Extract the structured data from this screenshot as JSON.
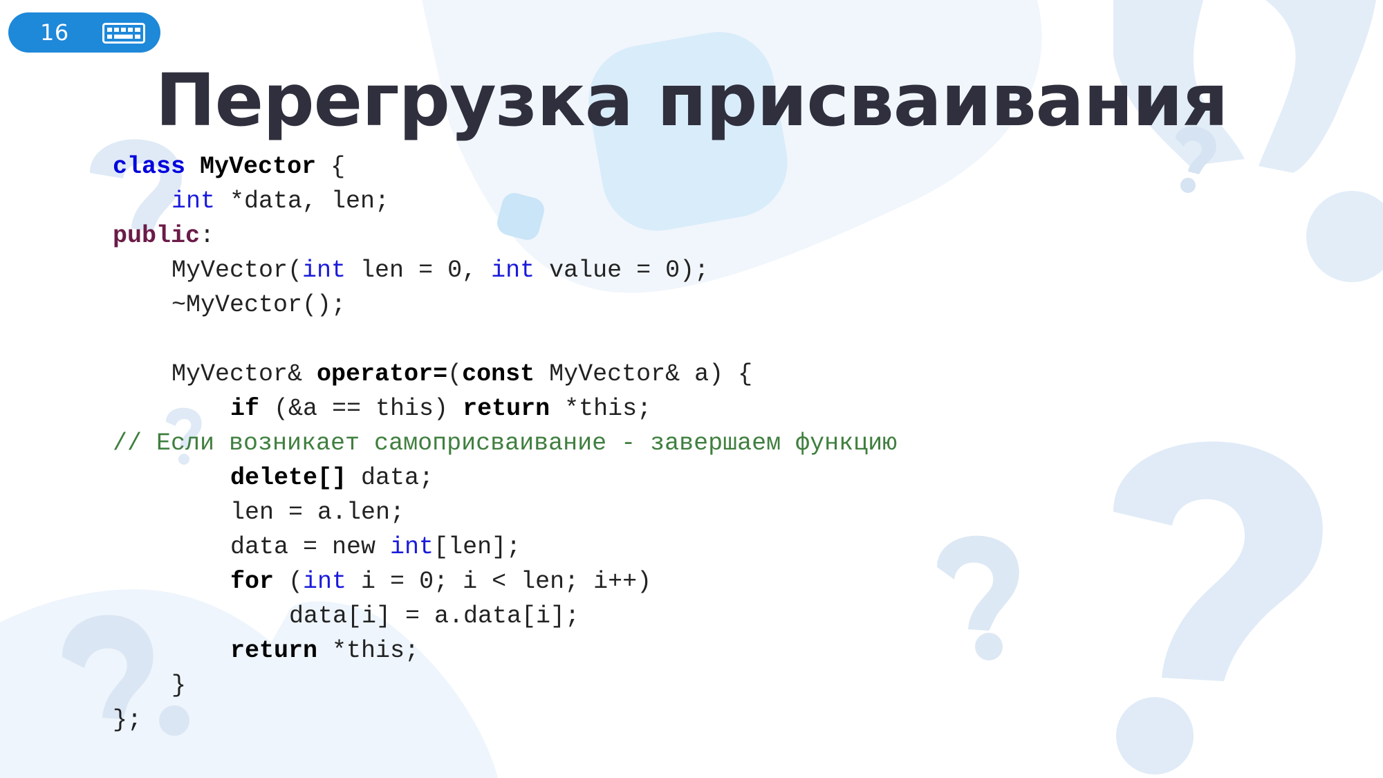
{
  "slide": {
    "number": "16",
    "badge_icon": "keyboard-icon",
    "title": "Перегрузка присваивания",
    "colors": {
      "badge": "#1e88d9",
      "title": "#2f2f3d",
      "keyword": "#0000dd",
      "type": "#1a1adb",
      "access_specifier": "#6b1b47",
      "comment": "#3f7f3f",
      "decoration": "#dbe8f6"
    }
  },
  "code": {
    "l1": {
      "kw": "class",
      "sp": " ",
      "name": "MyVector",
      "rest": " {"
    },
    "l2": {
      "type": "int",
      "rest": " *data, len;"
    },
    "l3": {
      "access": "public",
      "rest": ":"
    },
    "l4": {
      "a": "MyVector(",
      "t1": "int",
      "b": " len = 0, ",
      "t2": "int",
      "c": " value = 0);"
    },
    "l5": {
      "text": "~MyVector();"
    },
    "l6": {
      "text": ""
    },
    "l7": {
      "a": "MyVector& ",
      "op": "operator=",
      "b": "(",
      "const": "const",
      "c": " MyVector& a) {"
    },
    "l8": {
      "kw": "if",
      "a": " (&a == this) ",
      "ret": "return",
      "b": " *this;"
    },
    "l9": {
      "comment": "// Если возникает самоприсваивание - завершаем функцию"
    },
    "l10": {
      "kw": "delete[]",
      "rest": " data;"
    },
    "l11": {
      "text": "len = a.len;"
    },
    "l12": {
      "a": "data = new ",
      "type": "int",
      "b": "[len];"
    },
    "l13": {
      "kw": "for",
      "a": " (",
      "type": "int",
      "b": " i = 0; i < len; i++)"
    },
    "l14": {
      "text": "data[i] = a.data[i];"
    },
    "l15": {
      "kw": "return",
      "rest": " *this;"
    },
    "l16": {
      "text": "}"
    },
    "l17": {
      "text": "};"
    }
  }
}
